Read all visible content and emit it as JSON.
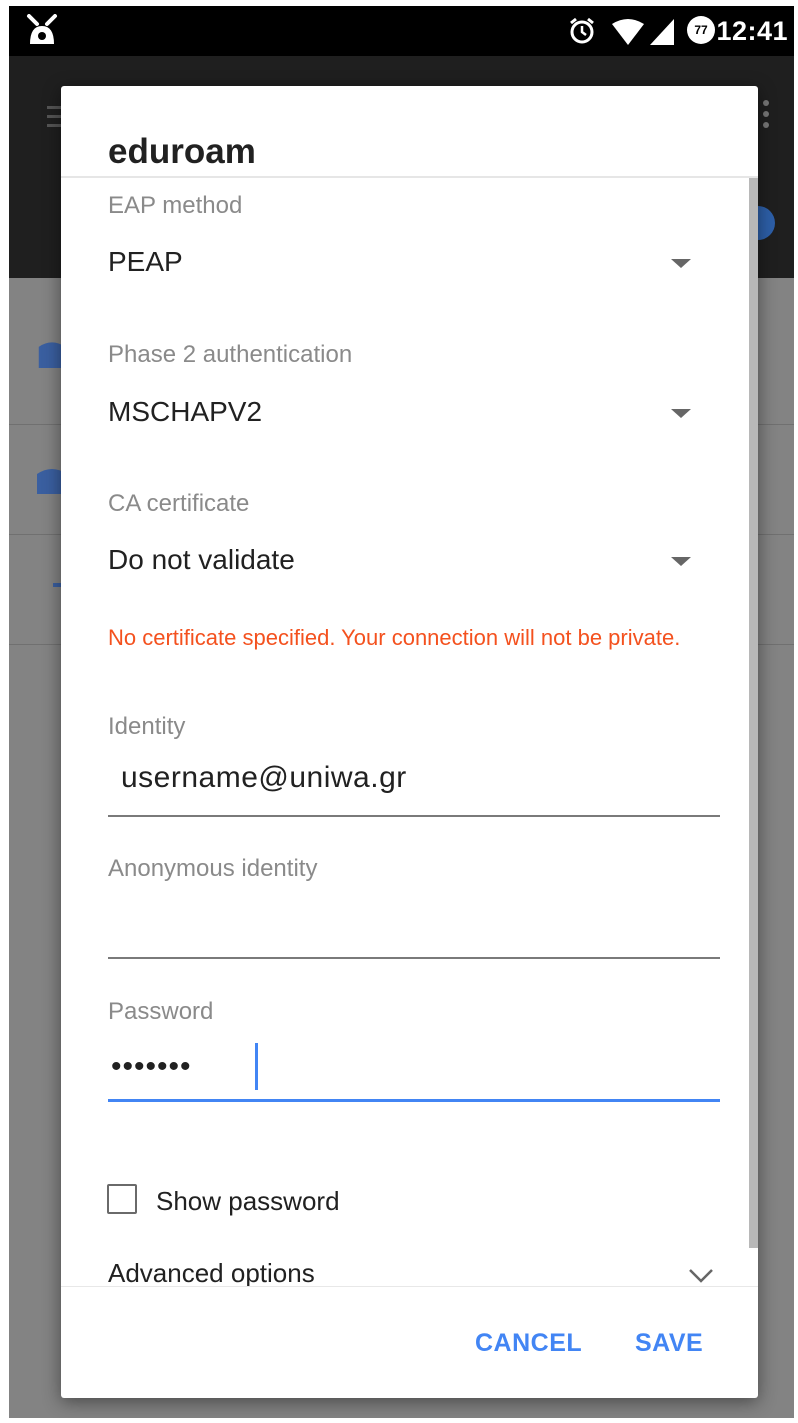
{
  "status_bar": {
    "app_icon": "android-debug-icon",
    "alarm_icon": "alarm-clock-icon",
    "wifi_icon": "wifi-signal-icon",
    "cell_icon": "cell-signal-icon",
    "battery_icon": "battery-saver-icon",
    "battery_level": "77",
    "time": "12:41"
  },
  "dialog": {
    "title": "eduroam",
    "eap_method": {
      "label": "EAP method",
      "value": "PEAP"
    },
    "phase2": {
      "label": "Phase 2 authentication",
      "value": "MSCHAPV2"
    },
    "ca_certificate": {
      "label": "CA certificate",
      "value": "Do not validate",
      "warning": "No certificate specified. Your connection will not be private."
    },
    "identity": {
      "label": "Identity",
      "value": "username@uniwa.gr"
    },
    "anonymous_identity": {
      "label": "Anonymous identity",
      "value": ""
    },
    "password": {
      "label": "Password",
      "value": "•••••••"
    },
    "show_password": {
      "label": "Show password",
      "checked": false
    },
    "advanced_options": {
      "label": "Advanced options"
    },
    "actions": {
      "cancel": "CANCEL",
      "save": "SAVE"
    }
  },
  "colors": {
    "accent": "#4285f4",
    "warning": "#f4511e",
    "status_bar": "#000000",
    "app_bar": "#1f1f1f",
    "scrim": "#838383"
  }
}
